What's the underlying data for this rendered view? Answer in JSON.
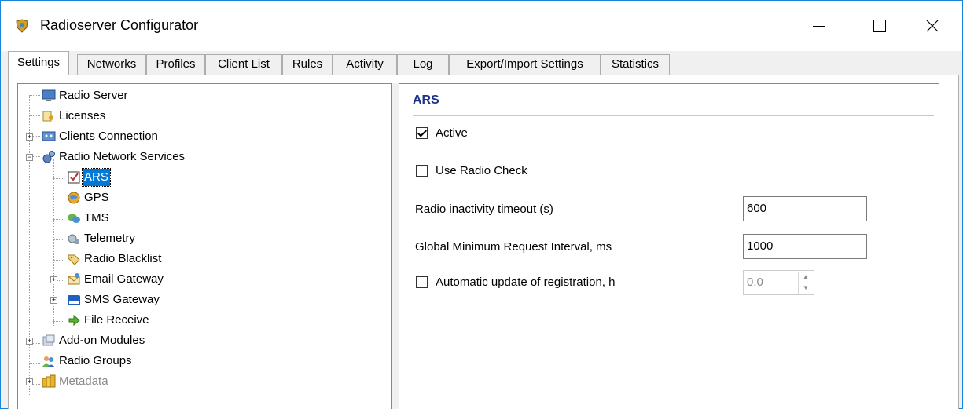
{
  "window": {
    "title": "Radioserver Configurator"
  },
  "tabs": [
    {
      "label": "Settings",
      "active": true
    },
    {
      "label": "Networks"
    },
    {
      "label": "Profiles"
    },
    {
      "label": "Client List"
    },
    {
      "label": "Rules"
    },
    {
      "label": "Activity"
    },
    {
      "label": "Log"
    },
    {
      "label": "Export/Import Settings"
    },
    {
      "label": "Statistics"
    }
  ],
  "tree": {
    "radio_server": "Radio Server",
    "licenses": "Licenses",
    "clients_connection": "Clients Connection",
    "radio_network_services": "Radio Network Services",
    "ars": "ARS",
    "gps": "GPS",
    "tms": "TMS",
    "telemetry": "Telemetry",
    "radio_blacklist": "Radio Blacklist",
    "email_gateway": "Email Gateway",
    "sms_gateway": "SMS Gateway",
    "file_receive": "File Receive",
    "addon_modules": "Add-on Modules",
    "radio_groups": "Radio Groups",
    "metadata": "Metadata",
    "expander_plus": "+",
    "expander_minus": "−"
  },
  "ars": {
    "title": "ARS",
    "active_label": "Active",
    "active_checked": true,
    "use_radio_check_label": "Use Radio Check",
    "use_radio_check_checked": false,
    "inactivity_label": "Radio inactivity timeout (s)",
    "inactivity_value": "600",
    "min_interval_label": "Global Minimum Request Interval, ms",
    "min_interval_value": "1000",
    "auto_update_label": "Automatic update of registration, h",
    "auto_update_checked": false,
    "auto_update_value": "0.0",
    "spin_up": "▲",
    "spin_down": "▼"
  },
  "colors": {
    "accent": "#0078d7",
    "section_title": "#1e3287",
    "window_border": "#1883d7"
  }
}
